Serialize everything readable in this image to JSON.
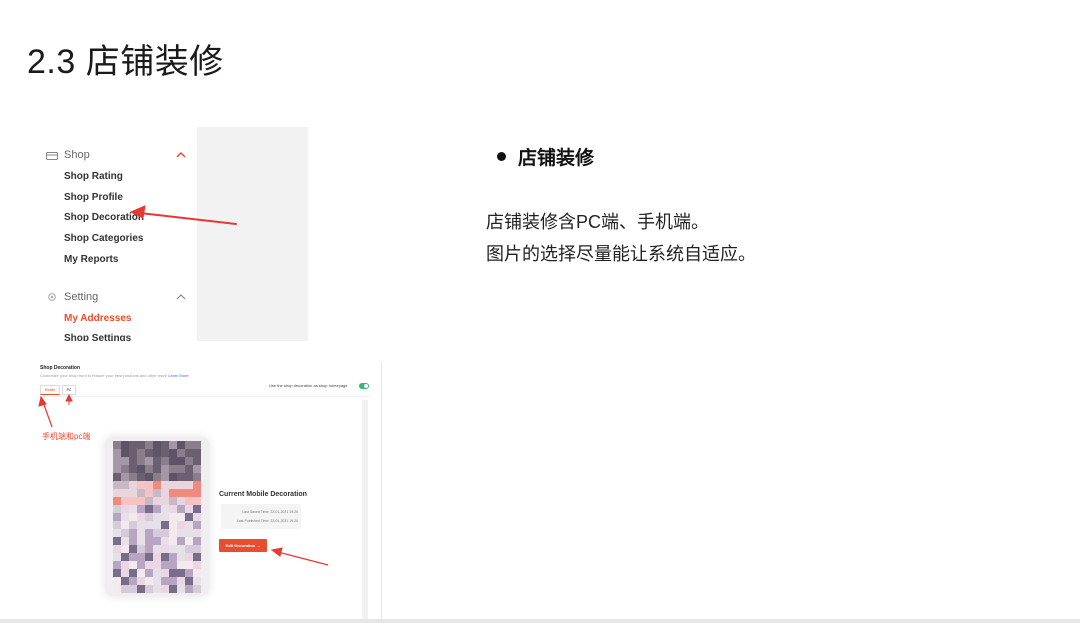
{
  "slide": {
    "title": "2.3 店铺装修"
  },
  "sidebar": {
    "shop_group": "Shop",
    "shop_items": [
      "Shop Rating",
      "Shop Profile",
      "Shop Decoration",
      "Shop Categories",
      "My Reports"
    ],
    "setting_group": "Setting",
    "setting_items": [
      "My Addresses",
      "Shop Settings"
    ],
    "active_item": "My Addresses",
    "accent": "#e84d2f"
  },
  "bullet": {
    "title": "店铺装修"
  },
  "description": {
    "line1": "店铺装修含PC端、手机端。",
    "line2": "图片的选择尽量能让系统自适应。"
  },
  "decoration": {
    "title": "Shop Decoration",
    "subtitle": "Customize your shop front to feature your best products and other more",
    "learn_more": "Learn More",
    "tabs": [
      "Mobile",
      "PC"
    ],
    "toggle_label": "Use the shop decoration as shop homepage",
    "toggle_on": true,
    "annotation": "手机端和pc端",
    "current_title": "Current Mobile Decoration",
    "last_saved": "Last Saved Time: 22-01-2021 19:20",
    "last_published": "Last Published Time: 22-01-2021 19:20",
    "edit_button": "Edit Decoration"
  },
  "colors": {
    "accent": "#e84d2f",
    "arrow": "#e53935",
    "toggle": "#3cb371"
  }
}
